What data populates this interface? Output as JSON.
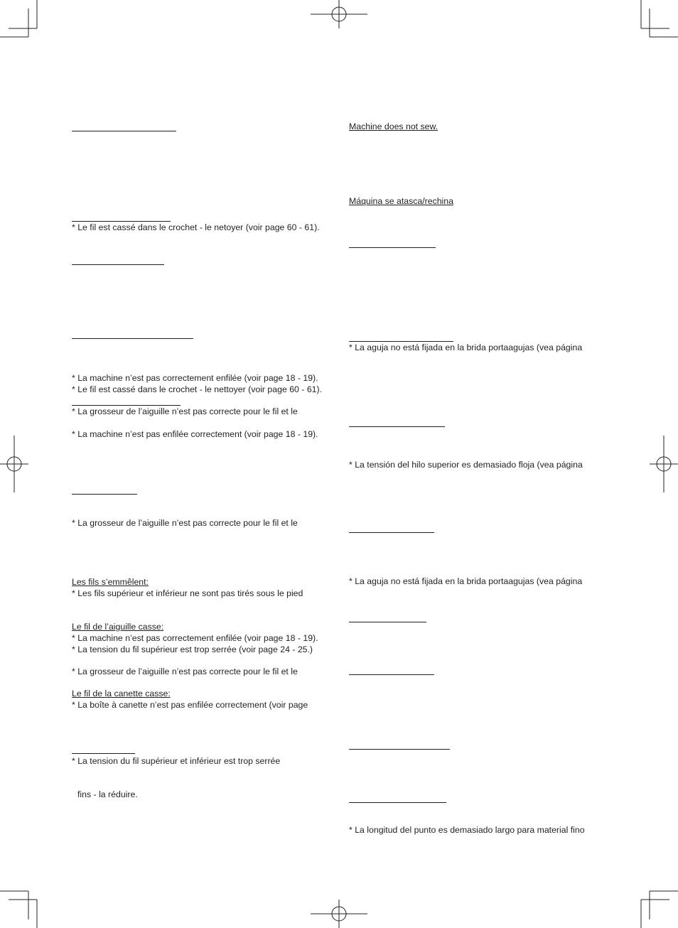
{
  "left_column": {
    "lines": [
      "* Le fil est cassé dans le crochet - le netoyer (voir page 60 - 61).",
      "* La machine n’est pas correctement enfilée (voir page 18 - 19).",
      "* Le fil est cassé dans le crochet - le nettoyer (voir page 60 - 61).",
      "* La grosseur de l’aiguille n’est pas correcte pour le fil et le",
      "* La machine n’est pas enfilée correctement (voir page 18 - 19).",
      "* La grosseur de l’aiguille n’est pas correcte pour le fil et le",
      "Les fils s’emmêlent:",
      "* Les fils supérieur et inférieur ne sont pas tirés sous le pied",
      "Le fil de l’aiguille casse:",
      "* La machine n’est pas correctement enfilée (voir page 18 - 19).",
      "* La tension du fil supérieur est trop serrée (voir page 24 - 25.)",
      "* La grosseur de l’aiguille n’est pas correcte pour le fil et le",
      "Le fil de la canette casse:",
      "* La boîte à canette n’est pas enfilée correctement (voir page",
      "* La tension du fil supérieur et inférieur est trop serrée",
      "fins - la réduire."
    ]
  },
  "right_column": {
    "lines": [
      "Machine does not sew.",
      "Máquina se atasca/rechina",
      "* La aguja no está fijada en la brida portaagujas (vea página",
      "* La tensión del hilo superior es demasiado floja (vea página",
      "* La aguja no está fijada en la brida portaagujas (vea página",
      "* La longitud del punto es demasiado largo para material fino"
    ]
  }
}
